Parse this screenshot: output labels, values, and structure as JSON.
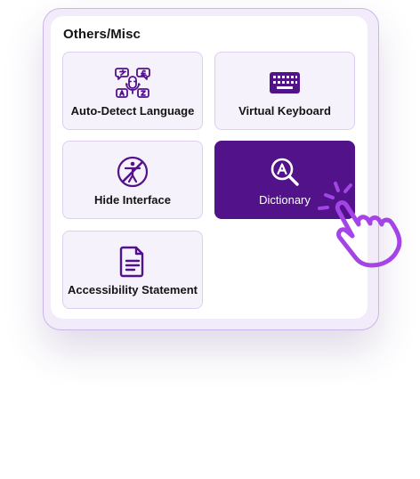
{
  "section": {
    "title": "Others/Misc"
  },
  "options": [
    {
      "label": "Auto-Detect Language",
      "icon": "translate-voice-icon",
      "active": false
    },
    {
      "label": "Virtual Keyboard",
      "icon": "keyboard-icon",
      "active": false
    },
    {
      "label": "Hide Interface",
      "icon": "hide-interface-icon",
      "active": false
    },
    {
      "label": "Dictionary",
      "icon": "dictionary-search-icon",
      "active": true
    },
    {
      "label": "Accessibility Statement",
      "icon": "document-icon",
      "active": false
    }
  ],
  "colors": {
    "accent": "#52128a",
    "tile_background": "#f6f2fc",
    "tile_border": "#ddd0ef",
    "panel_border": "#cdb5ea",
    "pointer_hand": "#a443e6"
  }
}
